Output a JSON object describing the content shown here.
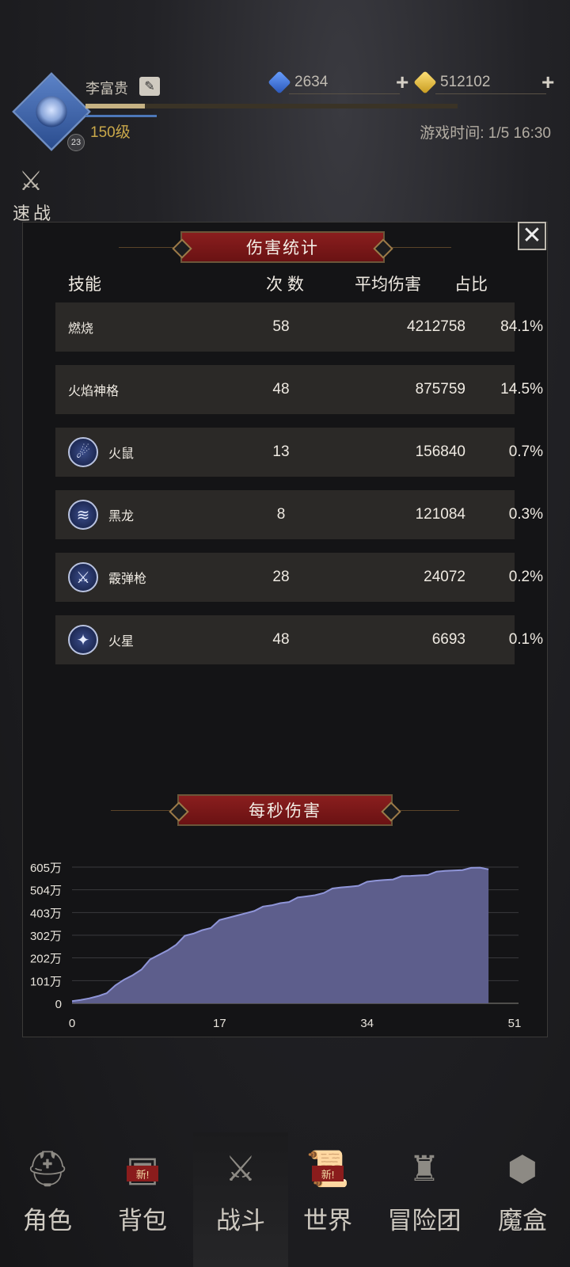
{
  "header": {
    "player_name": "李富贵",
    "level": "150级",
    "avatar_badge": "23",
    "diamonds": "2634",
    "gold": "512102",
    "game_time": "游戏时间: 1/5 16:30",
    "speed_label": "速战",
    "exp_progress": 0.16
  },
  "modal": {
    "title": "伤害统计",
    "columns": {
      "skill": "技能",
      "count": "次 数",
      "avg": "平均伤害",
      "pct": "占比"
    },
    "rows": [
      {
        "name": "燃烧",
        "count": "58",
        "avg": "4212758",
        "pct": "84.1%",
        "icon": ""
      },
      {
        "name": "火焰神格",
        "count": "48",
        "avg": "875759",
        "pct": "14.5%",
        "icon": ""
      },
      {
        "name": "火鼠",
        "count": "13",
        "avg": "156840",
        "pct": "0.7%",
        "icon": "fire-rat-icon"
      },
      {
        "name": "黑龙",
        "count": "8",
        "avg": "121084",
        "pct": "0.3%",
        "icon": "black-dragon-icon"
      },
      {
        "name": "霰弹枪",
        "count": "28",
        "avg": "24072",
        "pct": "0.2%",
        "icon": "shotgun-icon"
      },
      {
        "name": "火星",
        "count": "48",
        "avg": "6693",
        "pct": "0.1%",
        "icon": "spark-icon"
      }
    ],
    "dps_title": "每秒伤害"
  },
  "chart_data": {
    "type": "area",
    "title": "每秒伤害",
    "xlabel": "",
    "ylabel": "",
    "x_ticks": [
      "0",
      "17",
      "34",
      "51"
    ],
    "y_ticks": [
      "0",
      "101万",
      "202万",
      "302万",
      "403万",
      "504万",
      "605万"
    ],
    "xlim": [
      0,
      51
    ],
    "ylim": [
      0,
      605
    ],
    "y_unit": "万",
    "grid": true,
    "fill_color": "#5d5e8c",
    "line_color": "#8f95d8",
    "x": [
      0,
      1,
      2,
      3,
      4,
      5,
      6,
      7,
      8,
      9,
      10,
      11,
      12,
      13,
      14,
      15,
      16,
      17,
      18,
      19,
      20,
      21,
      22,
      23,
      24,
      25,
      26,
      27,
      28,
      29,
      30,
      31,
      32,
      33,
      34,
      35,
      36,
      37,
      38,
      39,
      40,
      41,
      42,
      43,
      44,
      45,
      46,
      47,
      48
    ],
    "values": [
      10,
      15,
      22,
      32,
      45,
      80,
      105,
      125,
      150,
      195,
      215,
      235,
      260,
      300,
      310,
      325,
      335,
      370,
      380,
      390,
      400,
      410,
      430,
      435,
      445,
      450,
      470,
      475,
      480,
      490,
      510,
      515,
      518,
      522,
      540,
      545,
      548,
      550,
      565,
      566,
      568,
      570,
      585,
      588,
      590,
      592,
      602,
      603,
      595
    ]
  },
  "nav": {
    "items": [
      {
        "label": "角色",
        "icon": "helmet-icon",
        "active": false,
        "badge": ""
      },
      {
        "label": "背包",
        "icon": "backpack-icon",
        "active": false,
        "badge": "新!"
      },
      {
        "label": "战斗",
        "icon": "shield-sword-icon",
        "active": true,
        "badge": ""
      },
      {
        "label": "世界",
        "icon": "scroll-map-icon",
        "active": false,
        "badge": "新!"
      },
      {
        "label": "冒险团",
        "icon": "castle-icon",
        "active": false,
        "badge": ""
      },
      {
        "label": "魔盒",
        "icon": "magic-box-icon",
        "active": false,
        "badge": ""
      }
    ]
  }
}
